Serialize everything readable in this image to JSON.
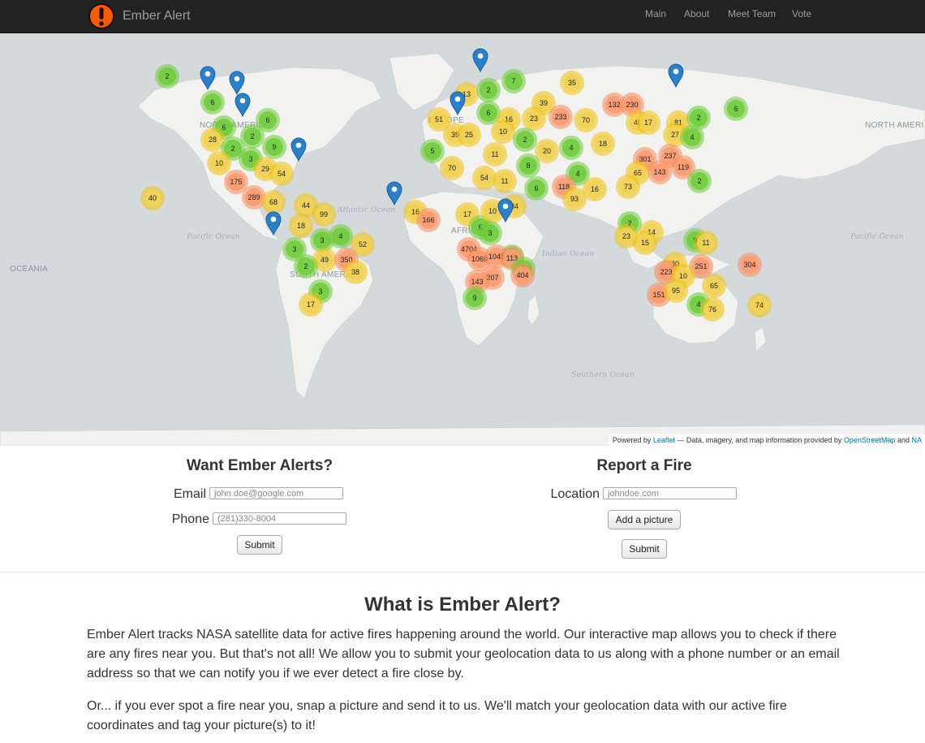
{
  "app": {
    "brand": "Ember Alert"
  },
  "nav": {
    "items": [
      "Main",
      "About",
      "Meet Team",
      "Vote"
    ]
  },
  "map": {
    "ocean_labels": [
      "Atlantic Ocean",
      "Pacific Ocean",
      "Pacific Ocean",
      "Indian Ocean",
      "Southern Ocean"
    ],
    "place_labels": [
      "NORTH AMERICA",
      "SOUTH AMERICA",
      "AFRICA",
      "EUROPE",
      "NORTH AMERI",
      "OCEANIA"
    ],
    "attribution": {
      "powered_by": "Powered by",
      "leaflet": "Leaflet",
      "text": "— Data, imagery, and map information provided by",
      "osm": "OpenStreetMap",
      "and": "and",
      "tail": "NA"
    },
    "clusters": [
      "2",
      "6",
      "6",
      "6",
      "2",
      "28",
      "2",
      "9",
      "3",
      "10",
      "29",
      "54",
      "175",
      "289",
      "68",
      "40",
      "44",
      "99",
      "18",
      "3",
      "4",
      "52",
      "3",
      "49",
      "350",
      "2",
      "38",
      "3",
      "17",
      "13",
      "2",
      "7",
      "35",
      "6",
      "39",
      "51",
      "16",
      "23",
      "233",
      "70",
      "132",
      "230",
      "40",
      "17",
      "81",
      "2",
      "27",
      "4",
      "6",
      "39",
      "25",
      "10",
      "2",
      "20",
      "4",
      "18",
      "5",
      "11",
      "8",
      "301",
      "237",
      "70",
      "54",
      "11",
      "4",
      "65",
      "143",
      "119",
      "2",
      "6",
      "118",
      "16",
      "73",
      "93",
      "16",
      "166",
      "17",
      "6",
      "10",
      "34",
      "7",
      "3",
      "4704",
      "1069",
      "1045",
      "113",
      "3",
      "404",
      "207",
      "143",
      "9",
      "2",
      "14",
      "23",
      "15",
      "9",
      "11",
      "30",
      "223",
      "251",
      "304",
      "10",
      "65",
      "151",
      "95",
      "4",
      "76",
      "74",
      "5"
    ],
    "pin_icon": "map-marker-icon"
  },
  "alerts_form": {
    "title": "Want Ember Alerts?",
    "email_label": "Email",
    "email_placeholder": "john.doe@google.com",
    "phone_label": "Phone",
    "phone_placeholder": "(281)330-8004",
    "submit": "Submit"
  },
  "report_form": {
    "title": "Report a Fire",
    "location_label": "Location",
    "location_placeholder": "johndoe.com",
    "add_picture": "Add a picture",
    "submit": "Submit"
  },
  "about": {
    "title": "What is Ember Alert?",
    "p1": "Ember Alert tracks NASA satellite data for active fires happening around the world. Our interactive map allows you to check if there are any fires near you. But that's not all! We allow you to submit your geolocation data to us along with a phone number or an email address so that we can notify you if we ever detect a fire close by.",
    "p2": "Or... if you ever spot a fire near you, snap a picture and send it to us. We'll match your geolocation data with our active fire coordinates and tag your picture(s) to it!"
  },
  "colors": {
    "navbar": "#222222",
    "cluster_small": "#6ecc39",
    "cluster_medium": "#f0c20c",
    "cluster_large": "#f18017",
    "pin": "#2a81cb",
    "logo_outer": "#ff5a00"
  }
}
